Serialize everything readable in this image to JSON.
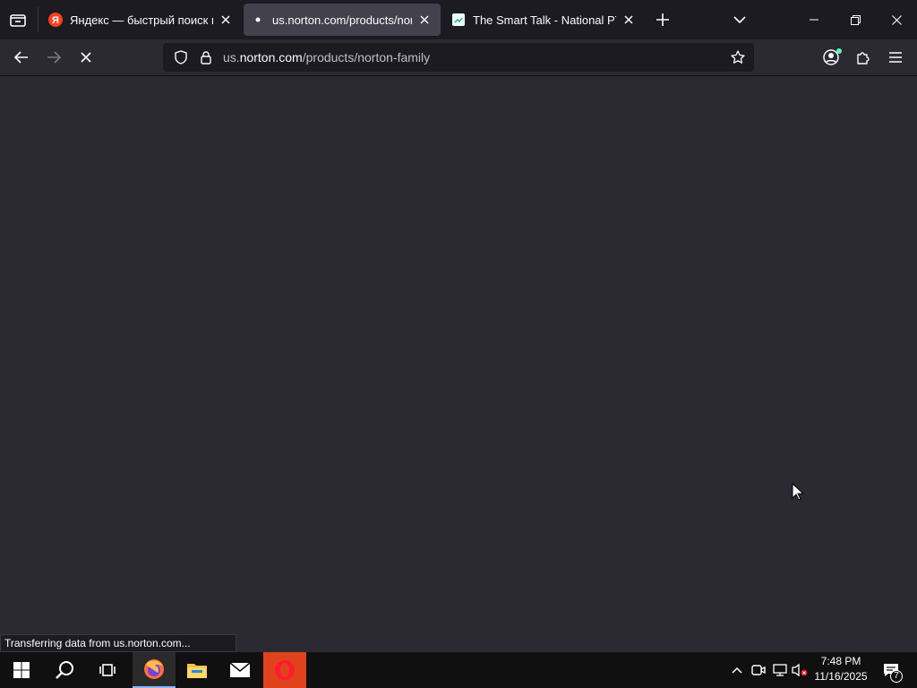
{
  "browser": {
    "tabs": [
      {
        "title": "Яндекс — быстрый поиск в интернете",
        "active": false,
        "favicon": "yandex-favicon"
      },
      {
        "title": "us.norton.com/products/norton-family",
        "active": true,
        "favicon": "loading-dot"
      },
      {
        "title": "The Smart Talk - National PTA + LifeSmarts",
        "active": false,
        "favicon": "smart-talk-favicon"
      }
    ],
    "url": {
      "prefix": "us.",
      "domain": "norton.com",
      "path": "/products/norton-family"
    },
    "status_text": "Transferring data from us.norton.com...",
    "accent": "#1c1b22"
  },
  "taskbar": {
    "clock_time": "7:48 PM",
    "clock_date": "11/16/2025",
    "notification_count": "7"
  }
}
